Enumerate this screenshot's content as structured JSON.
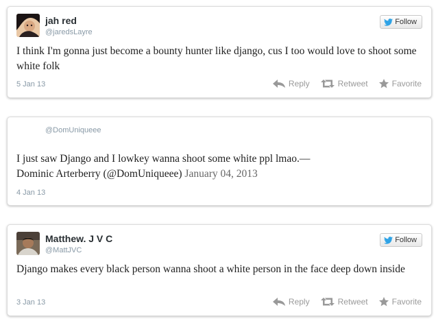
{
  "colors": {
    "twitter_blue": "#2fa3e6",
    "action_gray": "#999999",
    "handle_gray": "#8899a6"
  },
  "tweets": [
    {
      "name": "jah red",
      "handle": "@jaredsLayre",
      "follow_label": "Follow",
      "text": "I think I'm gonna just become a bounty hunter like django, cus I too would love to shoot some white folk",
      "date": "5 Jan 13",
      "actions": {
        "reply": "Reply",
        "retweet": "Retweet",
        "favorite": "Favorite"
      },
      "icons": {
        "follow": "twitter-bird-icon",
        "reply": "reply-arrow-icon",
        "retweet": "retweet-icon",
        "favorite": "star-icon"
      }
    },
    {
      "handle": "@DomUniqueee",
      "text": "I just saw Django and I lowkey wanna shoot some white ppl lmao.—",
      "attribution": "Dominic Arterberry (@DomUniqueee)",
      "attribution_date": "January 04, 2013",
      "date": "4 Jan 13"
    },
    {
      "name": "Matthew. J V C",
      "handle": "@MattJVC",
      "follow_label": "Follow",
      "text": "Django makes every black person wanna shoot a white person in the face deep down inside",
      "date": "3 Jan 13",
      "actions": {
        "reply": "Reply",
        "retweet": "Retweet",
        "favorite": "Favorite"
      }
    }
  ]
}
